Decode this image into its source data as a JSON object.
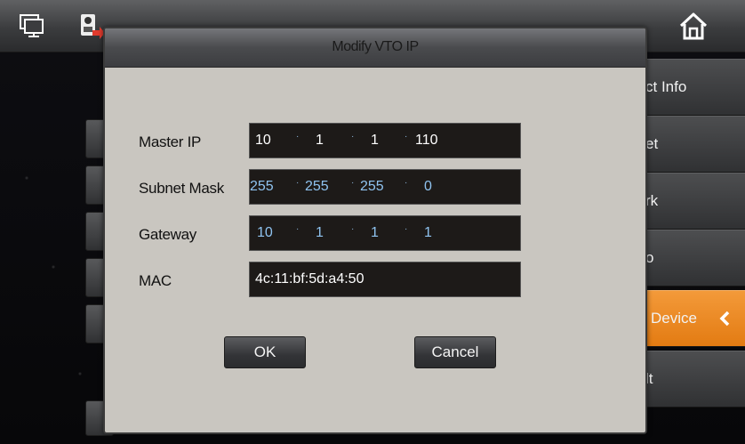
{
  "dialog": {
    "title": "Modify VTO IP",
    "ok_label": "OK",
    "cancel_label": "Cancel",
    "fields": {
      "master_ip": {
        "label": "Master IP",
        "octets": [
          "10",
          "1",
          "1",
          "110"
        ]
      },
      "subnet_mask": {
        "label": "Subnet Mask",
        "octets": [
          "255",
          "255",
          "255",
          "0"
        ]
      },
      "gateway": {
        "label": "Gateway",
        "octets": [
          "10",
          "1",
          "1",
          "1"
        ]
      },
      "mac": {
        "label": "MAC",
        "value": "4c:11:bf:5d:a4:50"
      }
    }
  },
  "sidebar": {
    "items": [
      {
        "label": "ct Info"
      },
      {
        "label": "et"
      },
      {
        "label": "rk"
      },
      {
        "label": "o"
      },
      {
        "label": "Device",
        "active": true
      },
      {
        "label": "lt"
      }
    ]
  },
  "topbar": {
    "icons": [
      "monitor-icon",
      "device-transfer-icon",
      "home-icon"
    ]
  },
  "colors": {
    "accent_orange": "#e8861f",
    "dialog_bg": "#c9c6c0",
    "field_bg": "#1d1a18",
    "field_text_blue": "#8fc3f0"
  }
}
